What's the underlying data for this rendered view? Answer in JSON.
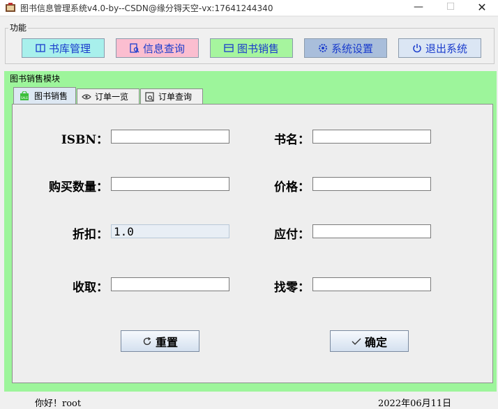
{
  "window": {
    "title": "图书信息管理系统v4.0-by--CSDN@缘分锝天空-vx:17641244340",
    "min_glyph": "—",
    "max_glyph": "☐",
    "close_glyph": "✕"
  },
  "function_group": {
    "legend": "功能",
    "buttons": [
      {
        "label": "书库管理",
        "icon": "book-icon",
        "bg": "#a8f0ec"
      },
      {
        "label": "信息查询",
        "icon": "document-search-icon",
        "bg": "#fbbed0"
      },
      {
        "label": "图书销售",
        "icon": "store-icon",
        "bg": "#a6f59e"
      },
      {
        "label": "系统设置",
        "icon": "gear-icon",
        "bg": "#a9bedb"
      },
      {
        "label": "退出系统",
        "icon": "power-icon",
        "bg": "#dbe6f4"
      }
    ]
  },
  "module": {
    "title": "图书销售模块",
    "tabs": [
      {
        "label": "图书销售",
        "icon": "sale-tag-icon"
      },
      {
        "label": "订单一览",
        "icon": "eye-icon"
      },
      {
        "label": "订单查询",
        "icon": "search-page-icon"
      }
    ]
  },
  "form": {
    "isbn_label": "ISBN：",
    "isbn_value": "",
    "title_label": "书名：",
    "title_value": "",
    "qty_label": "购买数量：",
    "qty_value": "",
    "price_label": "价格：",
    "price_value": "",
    "discount_label": "折扣：",
    "discount_value": "1.0",
    "payable_label": "应付：",
    "payable_value": "",
    "received_label": "收取：",
    "received_value": "",
    "change_label": "找零：",
    "change_value": ""
  },
  "actions": {
    "reset_label": "重置",
    "confirm_label": "确定"
  },
  "status": {
    "greeting": "你好！root",
    "date": "2022年06月11日"
  },
  "colors": {
    "panel_green": "#9df59b",
    "button_text_blue": "#1a3ccc"
  }
}
